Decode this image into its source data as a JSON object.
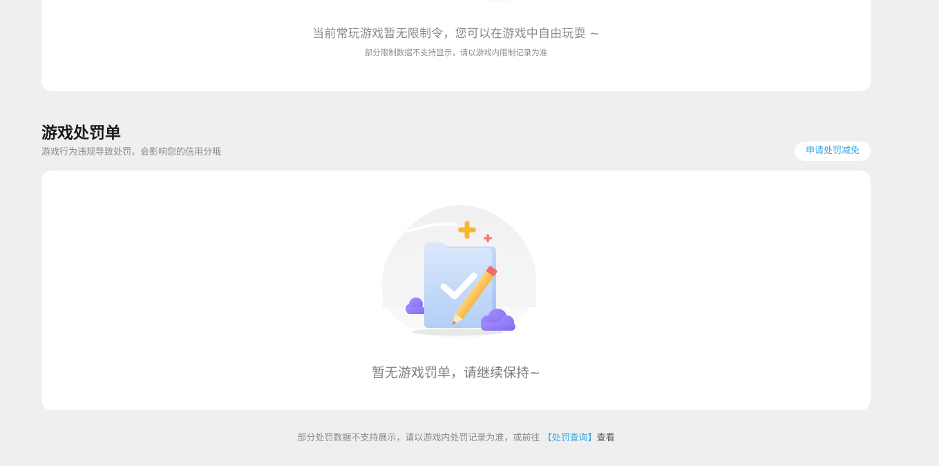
{
  "restriction_section": {
    "empty_message": "当前常玩游戏暂无限制令，您可以在游戏中自由玩耍 ~",
    "note": "部分限制数据不支持显示，请以游戏内限制记录为准"
  },
  "penalty_section": {
    "title": "游戏处罚单",
    "description": "游戏行为违规导致处罚，会影响您的信用分哦",
    "appeal_button_label": "申请处罚减免",
    "empty_message": "暂无游戏罚单，请继续保持~",
    "illustration_icon": "empty-folder-check-pencil-icon"
  },
  "footer": {
    "note_prefix": "部分处罚数据不支持展示，请以游戏内处罚记录为准，或前往",
    "link_label": "【处罚查询】",
    "note_suffix": "查看"
  },
  "colors": {
    "page_background": "#efefef",
    "card_background": "#ffffff",
    "accent": "#3aa7e0",
    "title": "#1a1a1a",
    "muted_text": "#8a8a8a"
  }
}
